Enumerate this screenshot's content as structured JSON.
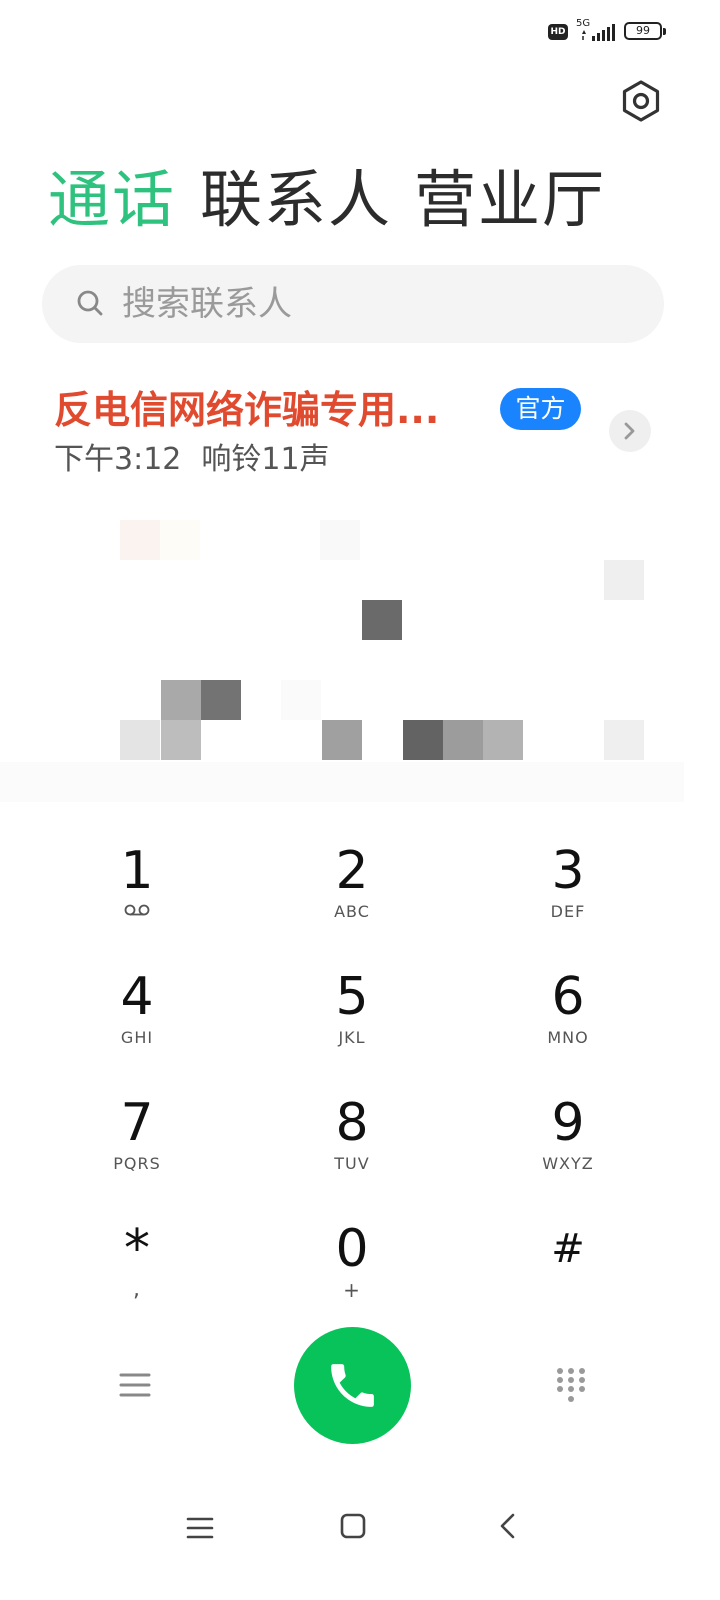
{
  "status_bar": {
    "hd": "HD",
    "network": "5G",
    "battery": "99"
  },
  "tabs": [
    {
      "label": "通话",
      "active": true
    },
    {
      "label": "联系人",
      "active": false
    },
    {
      "label": "营业厅",
      "active": false
    }
  ],
  "search": {
    "placeholder": "搜索联系人"
  },
  "call_log": [
    {
      "name": "反电信网络诈骗专用...",
      "badge": "官方",
      "time": "下午3:12",
      "status": "响铃11声"
    }
  ],
  "dialpad": {
    "keys": [
      {
        "digit": "1",
        "letters": ""
      },
      {
        "digit": "2",
        "letters": "ABC"
      },
      {
        "digit": "3",
        "letters": "DEF"
      },
      {
        "digit": "4",
        "letters": "GHI"
      },
      {
        "digit": "5",
        "letters": "JKL"
      },
      {
        "digit": "6",
        "letters": "MNO"
      },
      {
        "digit": "7",
        "letters": "PQRS"
      },
      {
        "digit": "8",
        "letters": "TUV"
      },
      {
        "digit": "9",
        "letters": "WXYZ"
      },
      {
        "digit": "*",
        "letters": ","
      },
      {
        "digit": "0",
        "letters": "+"
      },
      {
        "digit": "#",
        "letters": ""
      }
    ]
  },
  "colors": {
    "accent_green": "#2ec27e",
    "call_button": "#08c25a",
    "title_red": "#e04a2f",
    "badge_blue": "#1a84ff"
  },
  "icons": {
    "settings": "settings-icon",
    "search": "search-icon",
    "voicemail": "voicemail-icon",
    "call": "phone-icon",
    "menu": "menu-icon",
    "keypad": "keypad-icon"
  }
}
